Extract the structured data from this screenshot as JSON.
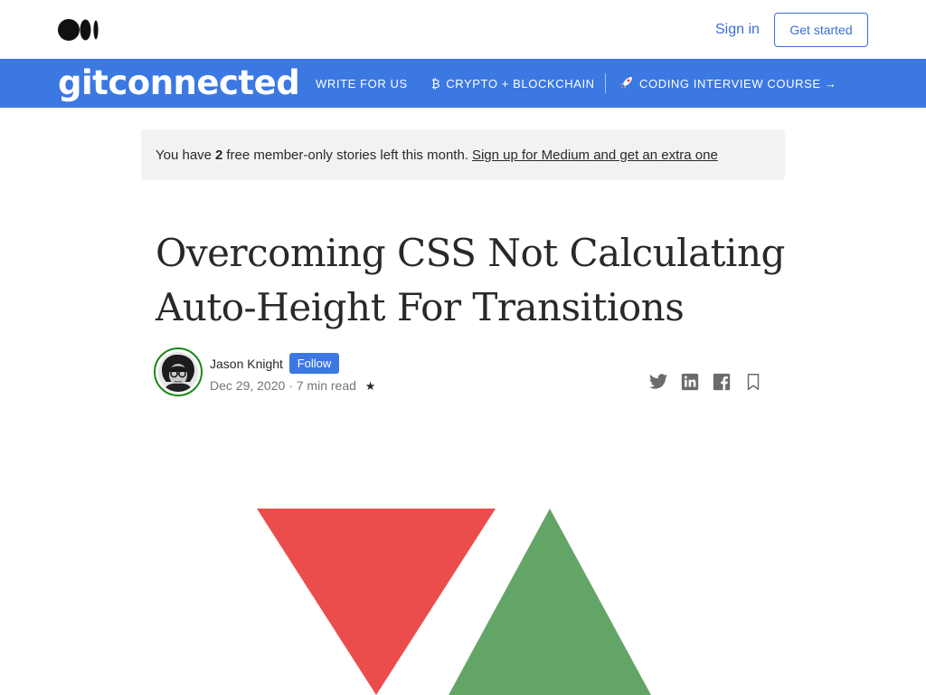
{
  "header": {
    "sign_in": "Sign in",
    "get_started": "Get started",
    "logo_icon": "medium-logo-icon"
  },
  "publication": {
    "name": "gitconnected",
    "color": "#3b78e2",
    "nav": [
      {
        "icon": "bitcoin-icon",
        "label": "WRITE FOR US"
      },
      {
        "icon": "bitcoin-icon",
        "glyph": "₿",
        "label": "CRYPTO + BLOCKCHAIN"
      },
      {
        "icon": "rocket-icon",
        "glyph": "🚀",
        "label": "CODING INTERVIEW COURSE →"
      }
    ]
  },
  "banner": {
    "prefix": "You have",
    "count": "2",
    "middle": "free member-only stories left this month.",
    "link": "Sign up for Medium and get an extra one"
  },
  "article": {
    "title": "Overcoming CSS Not Calculating Auto-Height For Transitions",
    "author": "Jason Knight",
    "follow_label": "Follow",
    "date": "Dec 29, 2020",
    "separator": "·",
    "read_time": "7 min read",
    "member_star": "★"
  },
  "share_icons": [
    "twitter-icon",
    "linkedin-icon",
    "facebook-icon",
    "bookmark-icon"
  ],
  "hero": {
    "colors": {
      "red": "#eb4d4d",
      "green": "#63a566"
    }
  }
}
